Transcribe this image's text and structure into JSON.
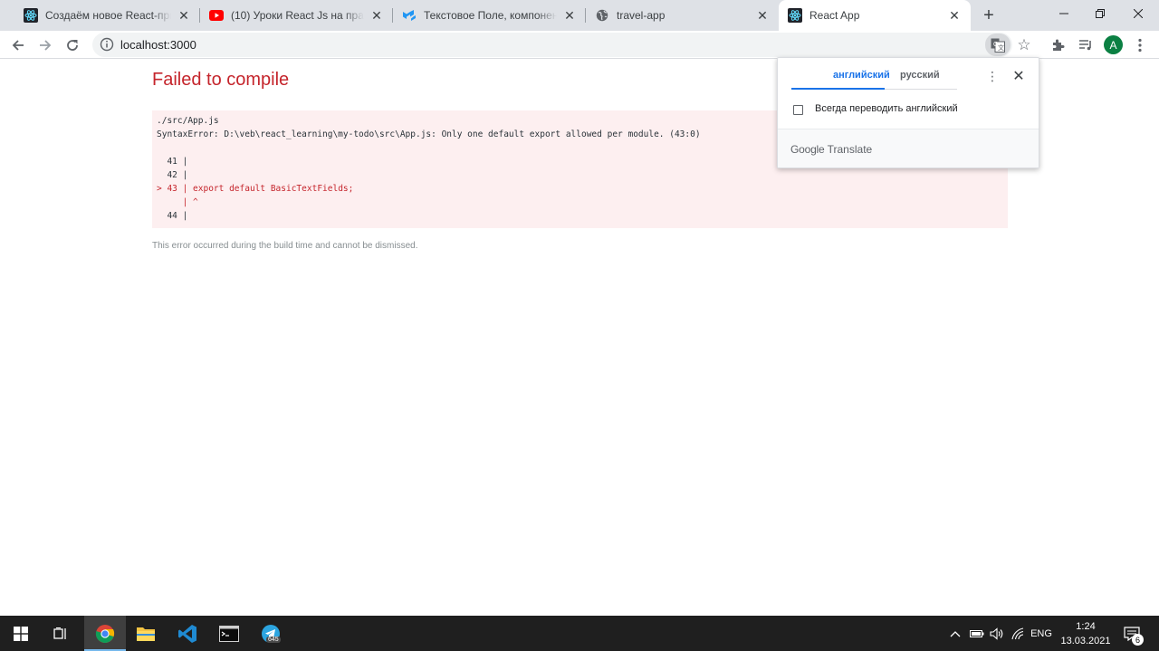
{
  "browser": {
    "tabs": [
      {
        "title": "Создаём новое React-прилож",
        "icon": "react-docs-icon"
      },
      {
        "title": "(10) Уроки React Js на практи",
        "icon": "youtube-icon"
      },
      {
        "title": "Текстовое Поле, компонент R",
        "icon": "material-ui-icon"
      },
      {
        "title": "travel-app",
        "icon": "globe-icon"
      },
      {
        "title": "React App",
        "icon": "react-icon"
      }
    ],
    "url": "localhost:3000",
    "avatar_letter": "A"
  },
  "page": {
    "title": "Failed to compile",
    "file": "./src/App.js",
    "message": "SyntaxError: D:\\veb\\react_learning\\my-todo\\src\\App.js: Only one default export allowed per module. (43:0)",
    "code_lines": [
      {
        "prefix": "  41 | ",
        "code": ""
      },
      {
        "prefix": "  42 | ",
        "code": ""
      },
      {
        "prefix": "> 43 | ",
        "code": "export default BasicTextFields;"
      },
      {
        "prefix": "     | ",
        "code": "^"
      },
      {
        "prefix": "  44 | ",
        "code": ""
      }
    ],
    "note": "This error occurred during the build time and cannot be dismissed."
  },
  "translate_popup": {
    "lang_source": "английский",
    "lang_target": "русский",
    "always_translate_label": "Всегда переводить английский",
    "always_translate_checked": false,
    "brand_google": "Google",
    "brand_translate": "Translate"
  },
  "taskbar": {
    "apps": [
      "chrome-icon",
      "file-explorer-icon",
      "vscode-icon",
      "terminal-icon",
      "telegram-icon"
    ],
    "telegram_badge": "645",
    "language": "ENG",
    "time": "1:24",
    "date": "13.03.2021",
    "notifications": "6"
  },
  "colors": {
    "error_red": "#c5252c",
    "error_bg": "#fdeff0",
    "accent_blue": "#1a73e8",
    "taskbar_bg": "#1f1f1f"
  }
}
